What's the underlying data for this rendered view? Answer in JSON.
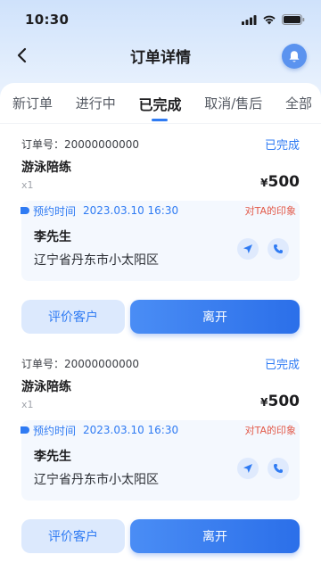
{
  "status_bar": {
    "time": "10:30"
  },
  "nav": {
    "title": "订单详情"
  },
  "tabs": [
    {
      "label": "新订单",
      "active": false
    },
    {
      "label": "进行中",
      "active": false
    },
    {
      "label": "已完成",
      "active": true
    },
    {
      "label": "取消/售后",
      "active": false
    },
    {
      "label": "全部",
      "active": false
    }
  ],
  "orders": [
    {
      "order_no": "订单号：20000000000",
      "status": "已完成",
      "service": "游泳陪练",
      "qty": "x1",
      "currency": "¥",
      "price": "500",
      "appt_label": "预约时间",
      "appt_time": "2023.03.10 16:30",
      "impression": "对TA的印象",
      "client_name": "李先生",
      "client_addr": "辽宁省丹东市小太阳区",
      "rate_label": "评价客户",
      "leave_label": "离开"
    },
    {
      "order_no": "订单号：20000000000",
      "status": "已完成",
      "service": "游泳陪练",
      "qty": "x1",
      "currency": "¥",
      "price": "500",
      "appt_label": "预约时间",
      "appt_time": "2023.03.10 16:30",
      "impression": "对TA的印象",
      "client_name": "李先生",
      "client_addr": "辽宁省丹东市小太阳区",
      "rate_label": "评价客户",
      "leave_label": "离开"
    }
  ],
  "icons": {
    "back": "chevron-left-icon",
    "bell": "bell-icon",
    "navigate": "location-arrow-icon",
    "phone": "phone-icon"
  },
  "colors": {
    "accent": "#2f7bf3",
    "impression": "#e25a4a",
    "background": "#e9f2fd"
  }
}
